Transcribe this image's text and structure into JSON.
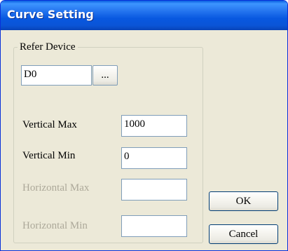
{
  "window": {
    "title": "Curve Setting"
  },
  "refer_device": {
    "group_label": "Refer Device",
    "device_value": "D0",
    "browse_label": "..."
  },
  "vertical_max": {
    "label": "Vertical Max",
    "value": "1000"
  },
  "vertical_min": {
    "label": "Vertical Min",
    "value": "0"
  },
  "horizontal_max": {
    "label": "Horizontal Max",
    "value": "",
    "enabled": false
  },
  "horizontal_min": {
    "label": "Horizontal Min",
    "value": "",
    "enabled": false
  },
  "buttons": {
    "ok_label": "OK",
    "cancel_label": "Cancel"
  },
  "colors": {
    "title_bar": "#0a54d6",
    "dialog_face": "#ece9d8",
    "disabled_text": "#aca899",
    "textbox_border": "#7f9db9",
    "button_border": "#003c74"
  }
}
